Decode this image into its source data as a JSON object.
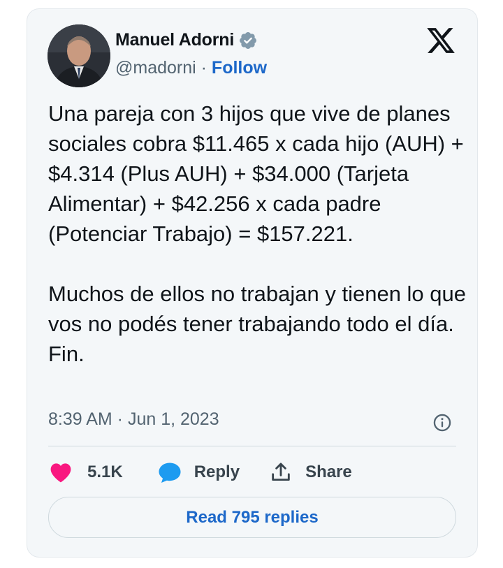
{
  "author": {
    "name": "Manuel Adorni",
    "handle": "@madorni",
    "separator": " · ",
    "follow_label": "Follow"
  },
  "icons": {
    "verified": "verified-badge-icon",
    "brand": "x-logo-icon",
    "info": "info-icon",
    "like": "heart-icon",
    "reply": "speech-bubble-icon",
    "share": "share-upload-icon"
  },
  "tweet": {
    "paragraphs": [
      "Una pareja con 3 hijos que vive de planes sociales cobra $11.465 x cada hijo (AUH) + $4.314 (Plus AUH) + $34.000 (Tarjeta Alimentar) + $42.256 x cada padre (Potenciar Trabajo) = $157.221.",
      "Muchos de ellos no trabajan y tienen lo que vos no podés tener trabajando todo el día. Fin."
    ],
    "timestamp": "8:39 AM · Jun 1, 2023"
  },
  "actions": {
    "likes": "5.1K",
    "reply_label": "Reply",
    "share_label": "Share"
  },
  "read_replies_label": "Read 795 replies",
  "colors": {
    "card_background": "#f4f7f9",
    "text": "#0f1419",
    "secondary_text": "#536471",
    "link": "#1d68c9",
    "heart": "#f91880",
    "reply_bubble": "#1d9bf0",
    "verified": "#829aab"
  }
}
